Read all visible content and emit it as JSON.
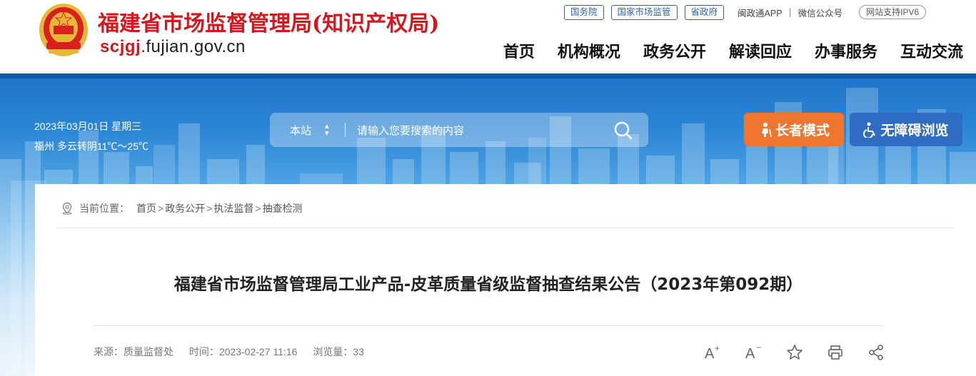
{
  "header": {
    "site_title": "福建省市场监督管理局(知识产权局)",
    "domain_prefix": "scjgj",
    "domain_rest": ".fujian.gov.cn",
    "top_links": {
      "pill1": "国务院",
      "pill2": "国家市场监管",
      "pill3": "省政府",
      "app": "闽政通APP",
      "sep": "|",
      "wechat": "微信公众号",
      "ipv6": "网站支持IPV6"
    },
    "nav": [
      "首页",
      "机构概况",
      "政务公开",
      "解读回应",
      "办事服务",
      "互动交流"
    ]
  },
  "banner": {
    "date": "2023年03月01日 星期三",
    "weather": "福州 多云转阴11℃～25℃",
    "search": {
      "scope": "本站",
      "placeholder": "请输入您要搜索的内容"
    },
    "elder_mode": "长者模式",
    "accessible": "无障碍浏览"
  },
  "breadcrumb": {
    "prefix": "当前位置：",
    "items": [
      "首页",
      "政务公开",
      "执法监督",
      "抽查检测"
    ],
    "gt": ">"
  },
  "article": {
    "title": "福建省市场监督管理局工业产品-皮革质量省级监督抽查结果公告（2023年第092期）",
    "source": "来源：质量监督处",
    "time": "时间：2023-02-27 11:16",
    "views": "浏览量：33"
  },
  "colors": {
    "brand_red": "#d3171f",
    "elder_orange": "#ef7631",
    "access_blue": "#2f6cc3",
    "banner_blue": "#1e73c8"
  },
  "icons": [
    "emblem-icon",
    "sort-arrows-icon",
    "search-icon",
    "elder-icon",
    "wheelchair-icon",
    "location-icon",
    "font-increase-icon",
    "font-decrease-icon",
    "star-icon",
    "print-icon",
    "share-icon"
  ]
}
